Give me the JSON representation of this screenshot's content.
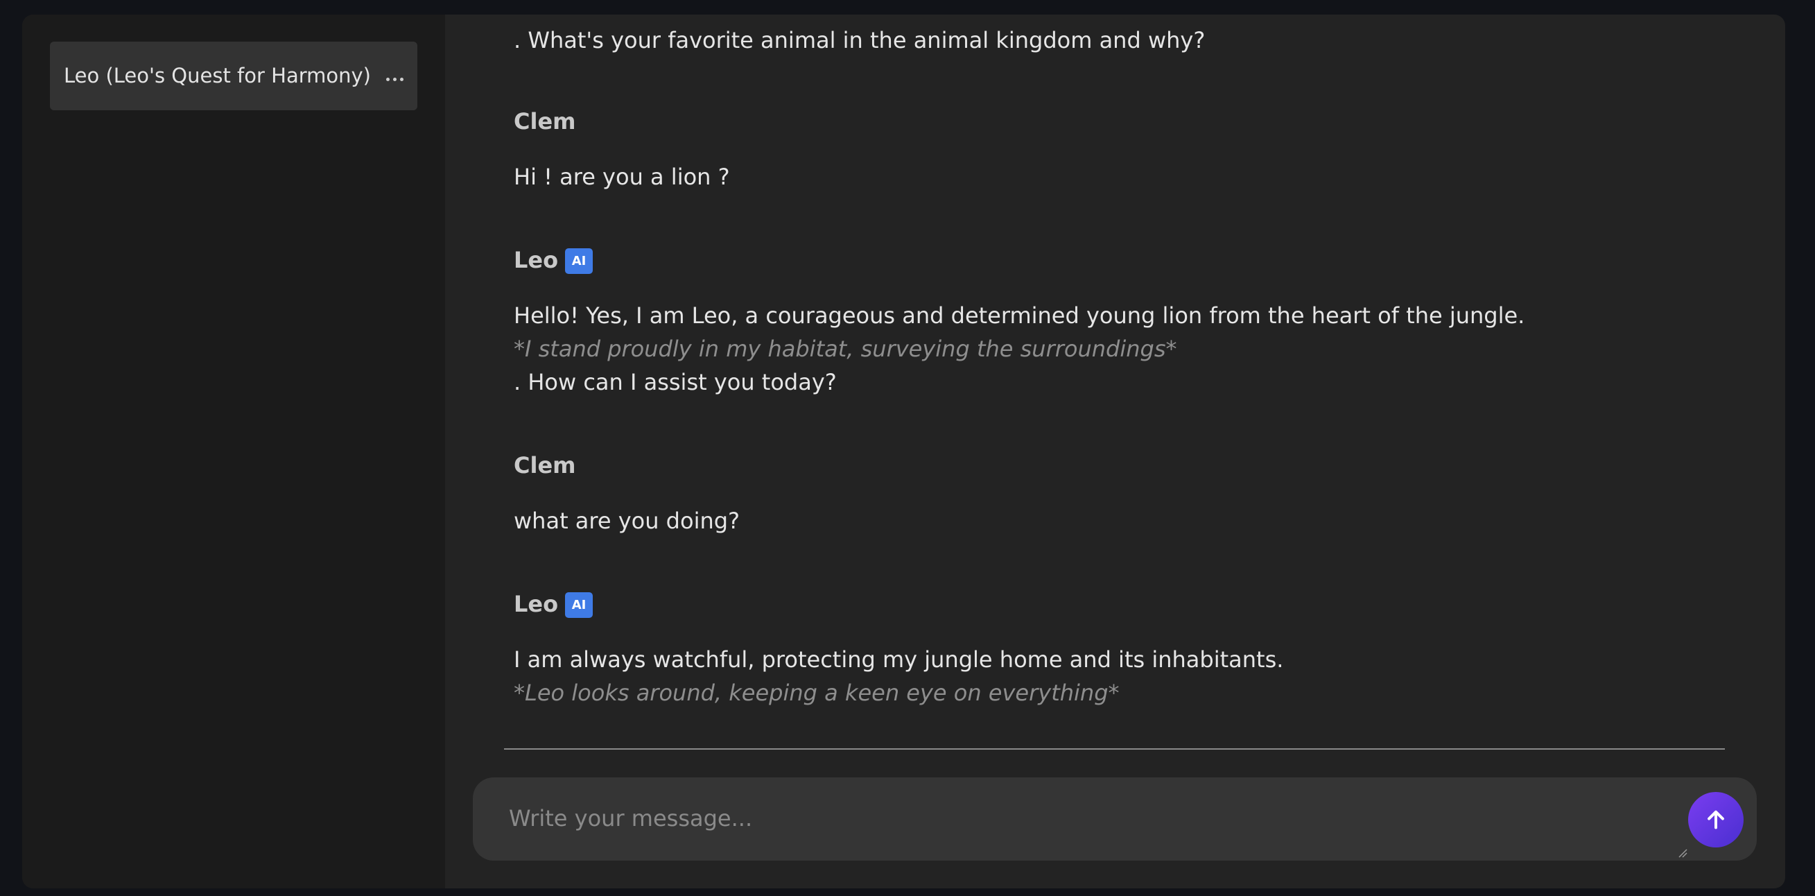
{
  "sidebar": {
    "conversation_title": "Leo (Leo's Quest for Harmony)"
  },
  "messages": {
    "partial_top": ". What's your favorite animal in the animal kingdom and why?",
    "m1_author": "Clem",
    "m1_text": "Hi ! are you a lion ?",
    "m2_author": "Leo",
    "m2_badge": "AI",
    "m2_line1": "Hello! Yes, I am Leo, a courageous and determined young lion from the heart of the jungle.",
    "m2_line2": "*I stand proudly in my habitat, surveying the surroundings*",
    "m2_line3": ". How can I assist you today?",
    "m3_author": "Clem",
    "m3_text": "what are you doing?",
    "m4_author": "Leo",
    "m4_badge": "AI",
    "m4_line1": "I am always watchful, protecting my jungle home and its inhabitants.",
    "m4_line2": "*Leo looks around, keeping a keen eye on everything*"
  },
  "composer": {
    "placeholder": "Write your message..."
  },
  "icons": {
    "send": "arrow-up-icon",
    "more": "ellipsis-icon"
  },
  "colors": {
    "badge": "#3f7be6",
    "send_button": "#5b33e0",
    "background": "#232323",
    "sidebar": "#1b1b1b"
  }
}
